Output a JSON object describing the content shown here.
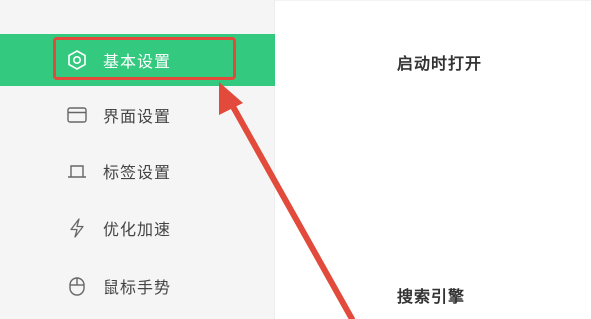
{
  "sidebar": {
    "items": [
      {
        "label": "基本设置",
        "icon": "settings-hexagon-icon",
        "active": true
      },
      {
        "label": "界面设置",
        "icon": "window-icon",
        "active": false
      },
      {
        "label": "标签设置",
        "icon": "tab-icon",
        "active": false
      },
      {
        "label": "优化加速",
        "icon": "lightning-icon",
        "active": false
      },
      {
        "label": "鼠标手势",
        "icon": "mouse-icon",
        "active": false
      }
    ]
  },
  "main": {
    "sections": [
      {
        "title": "启动时打开"
      },
      {
        "title": "搜索引擎"
      }
    ]
  },
  "colors": {
    "accent": "#33c97f",
    "annotation": "#e24a3b",
    "sidebar_bg": "#f5f5f5"
  }
}
